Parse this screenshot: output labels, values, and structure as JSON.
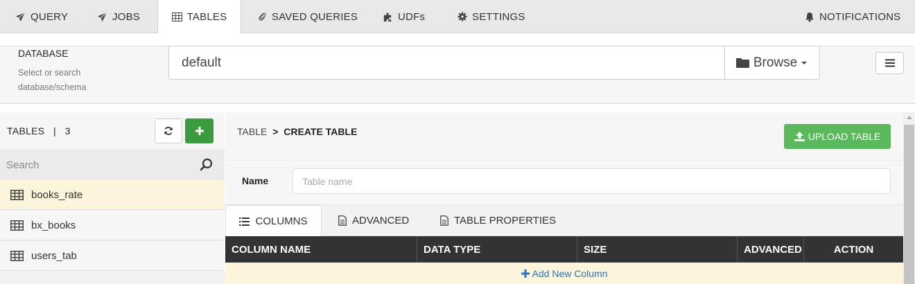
{
  "nav": {
    "tabs": [
      {
        "label": "QUERY",
        "icon": "paper-plane-icon"
      },
      {
        "label": "JOBS",
        "icon": "paper-plane-icon"
      },
      {
        "label": "TABLES",
        "icon": "table-icon",
        "active": true
      },
      {
        "label": "SAVED QUERIES",
        "icon": "paperclip-icon"
      },
      {
        "label": "UDFs",
        "icon": "puzzle-icon"
      },
      {
        "label": "SETTINGS",
        "icon": "gear-icon"
      }
    ],
    "notifications_label": "NOTIFICATIONS"
  },
  "database": {
    "title": "DATABASE",
    "hint": "Select or search database/schema",
    "value": "default",
    "browse_label": "Browse"
  },
  "sidebar": {
    "title": "TABLES",
    "count": "3",
    "search_placeholder": "Search",
    "tables": [
      {
        "name": "books_rate",
        "selected": true
      },
      {
        "name": "bx_books",
        "selected": false
      },
      {
        "name": "users_tab",
        "selected": false
      }
    ]
  },
  "main": {
    "breadcrumb_root": "TABLE",
    "breadcrumb_sep": ">",
    "breadcrumb_current": "CREATE TABLE",
    "upload_label": "UPLOAD TABLE",
    "name_label": "Name",
    "name_placeholder": "Table name",
    "subtabs": [
      {
        "label": "COLUMNS",
        "active": true
      },
      {
        "label": "ADVANCED",
        "active": false
      },
      {
        "label": "TABLE PROPERTIES",
        "active": false
      }
    ],
    "columns_header": [
      "COLUMN NAME",
      "DATA TYPE",
      "SIZE",
      "ADVANCED",
      "ACTION"
    ],
    "add_column_label": "Add New Column"
  },
  "colors": {
    "accent_green": "#5cb85c",
    "add_green": "#3c9a3f",
    "selected_row": "#fcf5dc",
    "table_header": "#333333",
    "link_blue": "#2a72b5"
  }
}
